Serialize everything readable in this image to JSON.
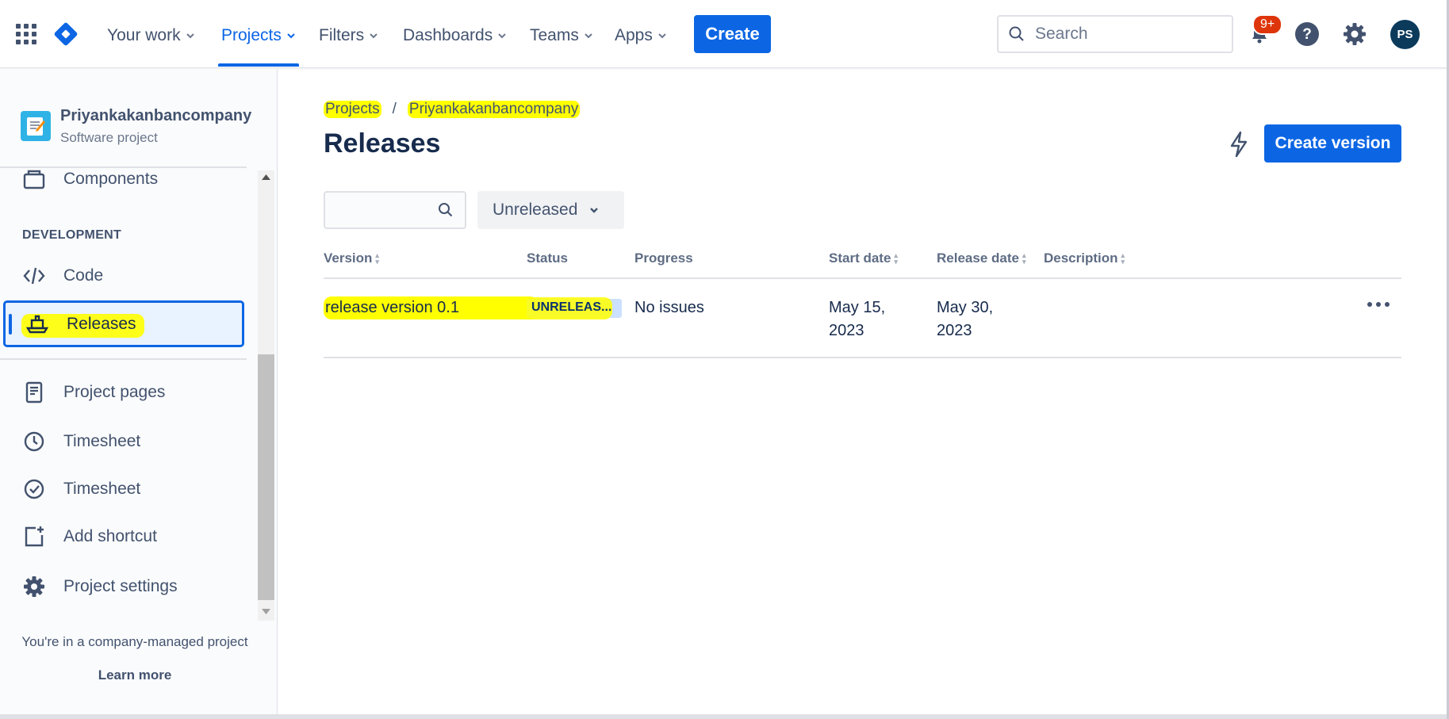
{
  "nav": {
    "items": [
      {
        "label": "Your work"
      },
      {
        "label": "Projects"
      },
      {
        "label": "Filters"
      },
      {
        "label": "Dashboards"
      },
      {
        "label": "Teams"
      },
      {
        "label": "Apps"
      }
    ],
    "create_label": "Create",
    "search_placeholder": "Search",
    "notifications_badge": "9+",
    "avatar_initials": "PS"
  },
  "sidebar": {
    "project_name": "Priyankakanbancompany",
    "project_type": "Software project",
    "items_top": [
      {
        "label": "Components",
        "icon": "component-icon"
      }
    ],
    "group_title": "DEVELOPMENT",
    "dev_items": [
      {
        "label": "Code",
        "icon": "code-icon"
      },
      {
        "label": "Releases",
        "icon": "ship-icon",
        "selected": true
      }
    ],
    "other_items": [
      {
        "label": "Project pages",
        "icon": "page-icon"
      },
      {
        "label": "Timesheet",
        "icon": "clock-icon"
      },
      {
        "label": "Timesheet",
        "icon": "check-circle-icon"
      },
      {
        "label": "Add shortcut",
        "icon": "add-shortcut-icon"
      },
      {
        "label": "Project settings",
        "icon": "gear-icon"
      }
    ],
    "footer_text": "You're in a company-managed project",
    "learn_more": "Learn more"
  },
  "main": {
    "breadcrumb": [
      "Projects",
      "/",
      "Priyankakanbancompany"
    ],
    "title": "Releases",
    "create_version_label": "Create version",
    "filter_search_value": "",
    "status_filter": "Unreleased",
    "columns": [
      "Version",
      "Status",
      "Progress",
      "Start date",
      "Release date",
      "Description"
    ],
    "rows": [
      {
        "version": "release version 0.1",
        "status": "UNRELEAS...",
        "progress": "No issues",
        "start_date_line1": "May 15,",
        "start_date_line2": "2023",
        "release_date_line1": "May 30,",
        "release_date_line2": "2023",
        "description": ""
      }
    ]
  },
  "colors": {
    "brand_blue": "#0c66e4",
    "highlight_yellow": "#ffff00",
    "badge_red": "#de350b",
    "lozenge_bg": "#cce0ff"
  }
}
